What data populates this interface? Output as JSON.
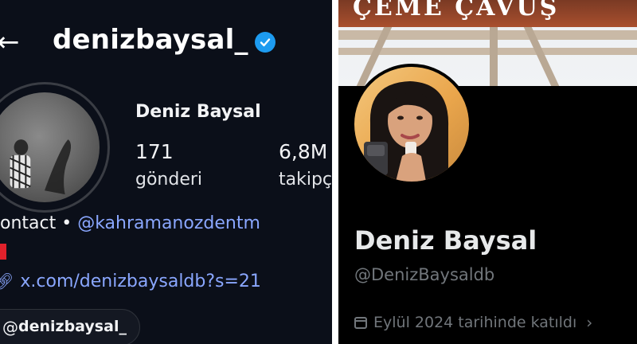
{
  "instagram": {
    "back_icon": "arrow-left-icon",
    "username": "denizbaysal_",
    "verified_icon": "verified-badge-icon",
    "display_name": "Deniz Baysal",
    "posts_count": "171",
    "posts_label": "gönderi",
    "followers_count": "6,8M",
    "followers_label": "takipç",
    "contact_prefix": "ontact •",
    "contact_mention": "kahramanozdentm",
    "link": "x.com/denizbaysaldb?s=21",
    "threads_handle": "denizbaysal_",
    "colors": {
      "background": "#0b0f19",
      "link": "#8aa7ff",
      "verified": "#1d9bf0"
    }
  },
  "x_profile": {
    "banner_sign_text": "ÇEME  ÇAVUŞ",
    "display_name": "Deniz Baysal",
    "handle": "@DenizBaysaldb",
    "joined": "Eylül 2024 tarihinde katıldı",
    "calendar_icon": "calendar-icon",
    "chevron_icon": "chevron-right-icon",
    "colors": {
      "background": "#000000",
      "muted": "#71767b"
    }
  }
}
